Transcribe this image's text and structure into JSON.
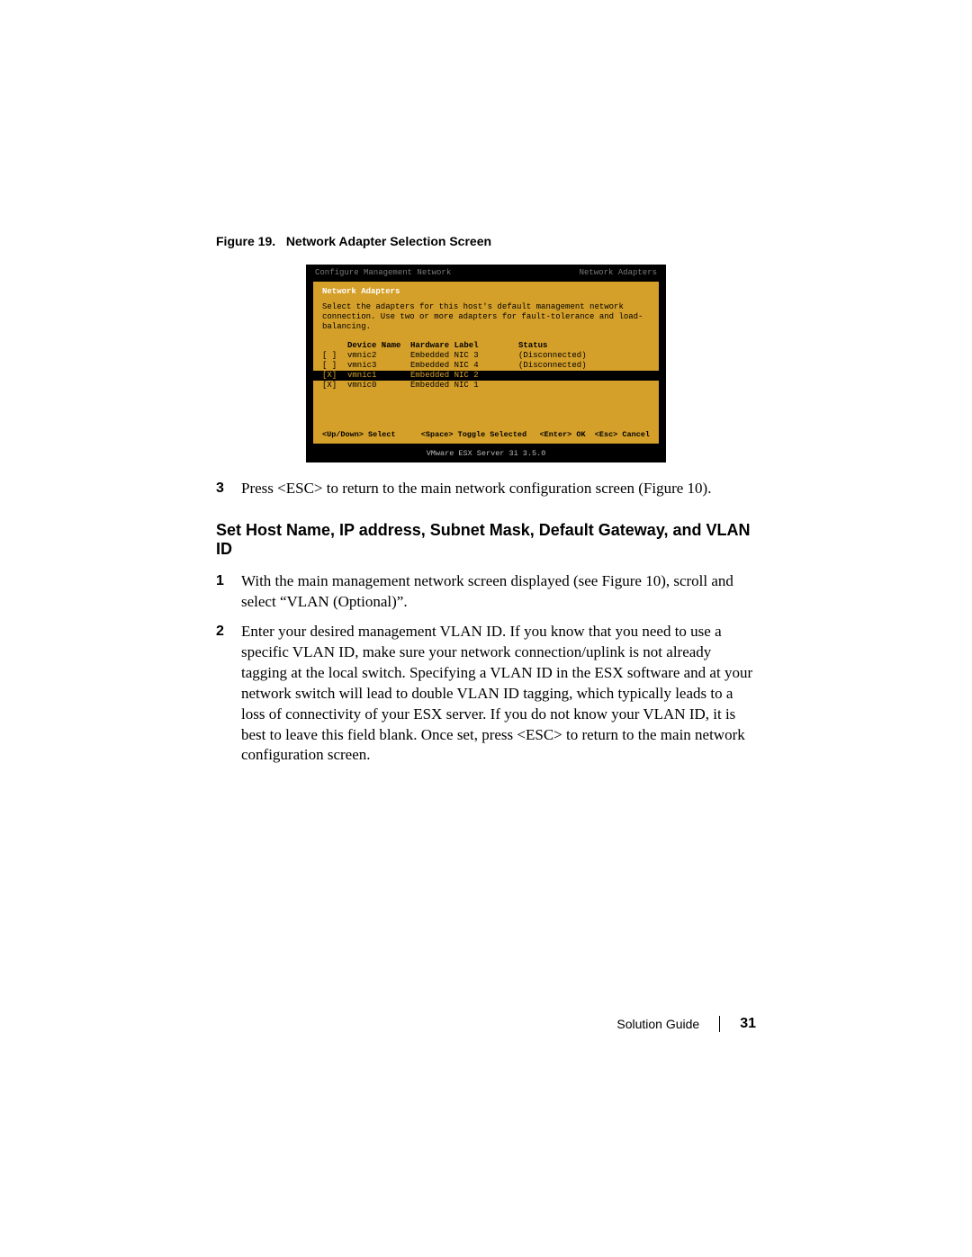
{
  "figure": {
    "label": "Figure 19.",
    "title": "Network Adapter Selection Screen"
  },
  "screenshot": {
    "header_left": "Configure Management Network",
    "header_right": "Network Adapters",
    "panel_title": "Network Adapters",
    "panel_desc": "Select the adapters for this host's default management network connection. Use two or more adapters for fault-tolerance and load-balancing.",
    "columns": {
      "device": "Device Name",
      "hardware": "Hardware Label",
      "status": "Status"
    },
    "rows": [
      {
        "mark": "[ ]",
        "name": "vmnic2",
        "hw": "Embedded NIC 3",
        "status": "(Disconnected)",
        "selected": false
      },
      {
        "mark": "[ ]",
        "name": "vmnic3",
        "hw": "Embedded NIC 4",
        "status": "(Disconnected)",
        "selected": false
      },
      {
        "mark": "[X]",
        "name": "vmnic1",
        "hw": "Embedded NIC 2",
        "status": "",
        "selected": true
      },
      {
        "mark": "[X]",
        "name": "vmnic0",
        "hw": "Embedded NIC 1",
        "status": "",
        "selected": false
      }
    ],
    "footer": {
      "updown": "<Up/Down> Select",
      "space": "<Space> Toggle Selected",
      "enter": "<Enter> OK",
      "esc": "<Esc> Cancel"
    },
    "bottom_bar": "VMware ESX Server 3i 3.5.0"
  },
  "steps_a": [
    {
      "num": "3",
      "text": "Press <ESC> to return to the main network configuration screen (Figure 10)."
    }
  ],
  "section_heading": "Set Host Name, IP address, Subnet Mask, Default Gateway, and VLAN ID",
  "steps_b": [
    {
      "num": "1",
      "text": "With the main management network screen displayed (see Figure 10), scroll and select “VLAN (Optional)”."
    },
    {
      "num": "2",
      "text": "Enter your desired management VLAN ID. If you know that you need to use a specific VLAN ID, make sure your network connection/uplink is not already tagging at the local switch. Specifying a VLAN ID in the ESX software and at your network switch will lead to double VLAN ID tagging, which typically leads to a loss of connectivity of your ESX server. If you do not know your VLAN ID, it is best to leave this field blank. Once set, press <ESC> to return to the main network configuration screen."
    }
  ],
  "footer": {
    "doc": "Solution Guide",
    "page": "31"
  }
}
